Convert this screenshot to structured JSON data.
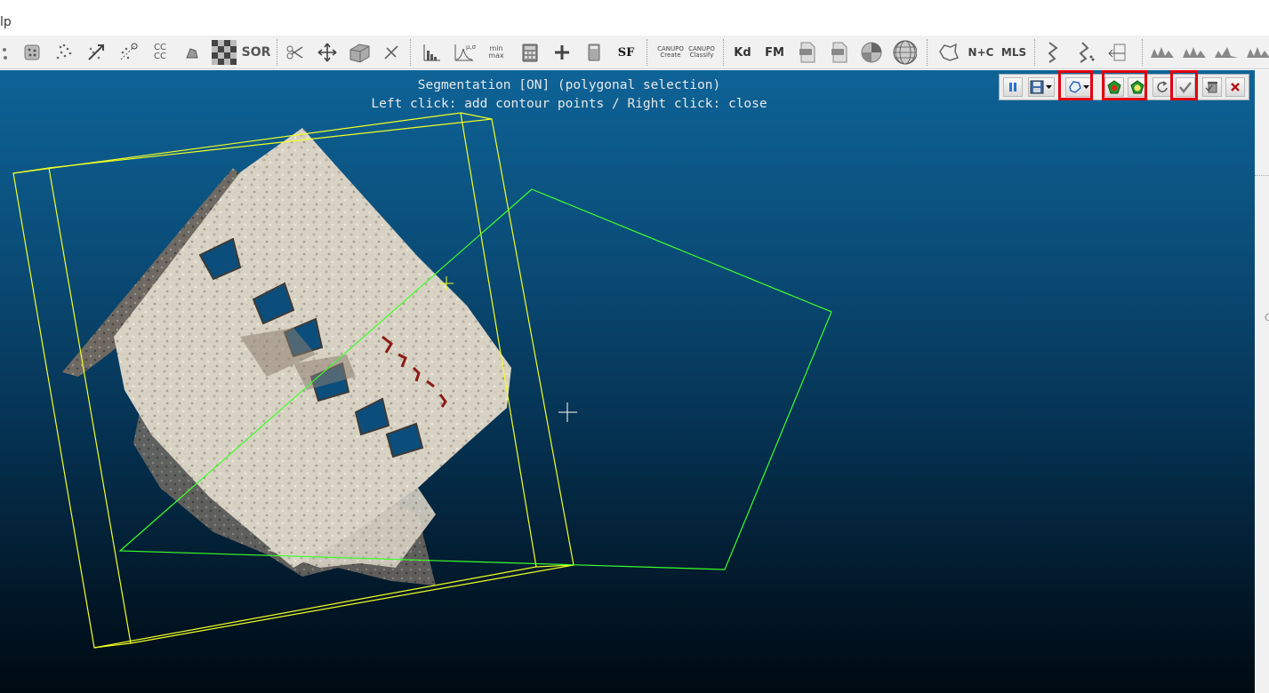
{
  "menubar": {
    "help_partial": "lp"
  },
  "toolbar": {
    "cc_label": "CC\nCC",
    "sor_label": "SOR",
    "sf_label": "SF",
    "minmax_label": "min\nmax",
    "canupo_create": "CANUPO\nCreate",
    "canupo_classify": "CANUPO\nClassify",
    "kd_label": "Kd",
    "fm_label": "FM",
    "nc_label": "N+C",
    "mls_label": "MLS"
  },
  "viewport": {
    "segmentation_title": "Segmentation [ON] (polygonal selection)",
    "segmentation_hint": "Left click: add contour points / Right click: close"
  },
  "segmentation_toolbar": {
    "buttons": [
      "pause-icon",
      "save-icon",
      "polygon-icon",
      "segment-in-icon",
      "segment-out-icon",
      "reset-icon",
      "confirm-icon",
      "confirm-delete-icon",
      "cancel-icon"
    ]
  },
  "colors": {
    "bbox": "#f2ff24",
    "polygon": "#3cff2a",
    "highlight": "#e1000f",
    "background_top": "#0e6397",
    "background_bottom": "#000a12"
  },
  "right_strip": {
    "mark": "C"
  }
}
